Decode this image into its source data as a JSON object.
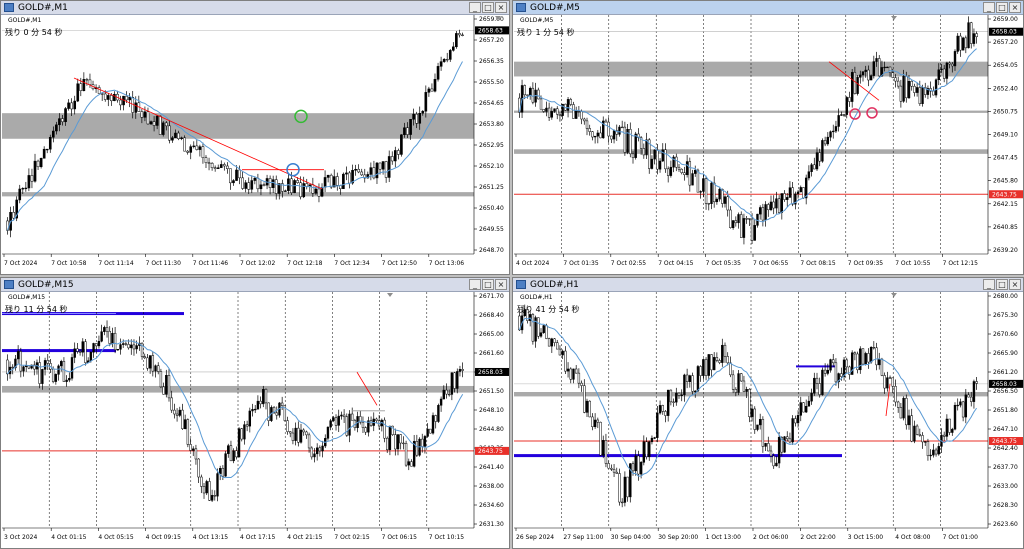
{
  "windows": [
    {
      "id": "m1",
      "title": "GOLD#,M1",
      "symbol": "GOLD#,M1",
      "countdown": "残り 0 分 54 秒",
      "active": false,
      "price_min": 2648.15,
      "price_max": 2659.35,
      "trend": [
        2649.7,
        2656.4,
        2654.2,
        2651.7,
        2651.2,
        2652.1,
        2658.6
      ],
      "price_labels": [
        "2659.00",
        "2657.20",
        "2656.35",
        "2655.50",
        "2654.65",
        "2653.80",
        "2652.95",
        "2652.10",
        "2651.25",
        "2650.40",
        "2649.55",
        "2648.70"
      ],
      "current_price": "2658.63",
      "current_value": 2658.63,
      "time_labels": [
        "7 Oct 2024",
        "7 Oct 10:58",
        "7 Oct 11:14",
        "7 Oct 11:30",
        "7 Oct 11:46",
        "7 Oct 12:02",
        "7 Oct 12:18",
        "7 Oct 12:34",
        "7 Oct 12:50",
        "7 Oct 13:06"
      ],
      "zones": [
        [
          2653.55,
          2654.75
        ],
        [
          2650.85,
          2651.05
        ]
      ],
      "red_lines": [],
      "blue_lines": [],
      "colors": {
        "zone": "#aaaaaa",
        "ma": "#5b9bd5",
        "trend": "#ff0000",
        "circle_green": "#33bb33",
        "circle_blue": "#3a7fd0"
      }
    },
    {
      "id": "m5",
      "title": "GOLD#,M5",
      "symbol": "GOLD#,M5",
      "countdown": "残り 1 分 54 秒",
      "active": true,
      "price_min": 2638.5,
      "price_max": 2659.5,
      "trend": [
        2652.2,
        2650.8,
        2647.9,
        2645.4,
        2640.5,
        2644.5,
        2655.2,
        2652.1,
        2658.7
      ],
      "price_labels": [
        "2659.00",
        "2658.03",
        "2657.20",
        "2654.05",
        "2652.40",
        "2650.75",
        "2649.10",
        "2647.45",
        "2645.80",
        "2643.75",
        "2642.15",
        "2640.85",
        "2639.20"
      ],
      "current_price": "2658.03",
      "current_value": 2658.03,
      "red_price": "2643.75",
      "red_value": 2643.75,
      "time_labels": [
        "4 Oct 2024",
        "7 Oct 01:35",
        "7 Oct 02:55",
        "7 Oct 04:15",
        "7 Oct 05:35",
        "7 Oct 06:55",
        "7 Oct 08:15",
        "7 Oct 09:35",
        "7 Oct 10:55",
        "7 Oct 12:15"
      ],
      "zones": [
        [
          2654.1,
          2655.4
        ],
        [
          2650.9,
          2651.1
        ],
        [
          2647.3,
          2647.7
        ]
      ],
      "red_lines": [
        2643.75
      ],
      "blue_lines": [],
      "colors": {
        "zone": "#aaaaaa",
        "ma": "#5b9bd5",
        "trend": "#ff0000",
        "circle": "#e03060",
        "red_tag": "#e8302a"
      }
    },
    {
      "id": "m15",
      "title": "GOLD#,M15",
      "symbol": "GOLD#,M15",
      "countdown": "残り 11 分 54 秒",
      "active": false,
      "price_min": 2629.8,
      "price_max": 2672.5,
      "trend": [
        2660.2,
        2657.0,
        2665.5,
        2658.5,
        2636.0,
        2653.0,
        2645.0,
        2650.0,
        2642.5,
        2659.0
      ],
      "price_labels": [
        "2671.70",
        "2668.40",
        "2665.00",
        "2661.60",
        "2658.03",
        "2654.90",
        "2651.50",
        "2648.10",
        "2644.80",
        "2643.35",
        "2641.40",
        "2638.00",
        "2634.60",
        "2631.30"
      ],
      "current_price": "2658.03",
      "current_value": 2658.03,
      "red_price": "2643.75",
      "red_value": 2643.75,
      "time_labels": [
        "3 Oct 2024",
        "4 Oct 01:15",
        "4 Oct 05:15",
        "4 Oct 09:15",
        "4 Oct 13:15",
        "4 Oct 17:15",
        "4 Oct 21:15",
        "7 Oct 02:15",
        "7 Oct 06:15",
        "7 Oct 10:15"
      ],
      "zones": [
        [
          2654.3,
          2655.5
        ]
      ],
      "red_lines": [
        2643.75
      ],
      "blue_lines": [
        2668.6
      ],
      "colors": {
        "zone": "#aaaaaa",
        "ma": "#5b9bd5",
        "trend": "#ff0000",
        "blue_zone": "#2200dd",
        "red_tag": "#e8302a"
      }
    },
    {
      "id": "h1",
      "title": "GOLD#,H1",
      "symbol": "GOLD#,H1",
      "countdown": "残り 41 分 54 秒",
      "active": false,
      "price_min": 2622.0,
      "price_max": 2681.0,
      "trend": [
        2675.0,
        2663.0,
        2630.0,
        2655.0,
        2665.0,
        2640.0,
        2660.0,
        2665.0,
        2640.0,
        2657.0
      ],
      "price_labels": [
        "2680.00",
        "2675.30",
        "2670.60",
        "2665.90",
        "2661.20",
        "2658.03",
        "2656.50",
        "2651.80",
        "2647.10",
        "2643.75",
        "2642.40",
        "2637.70",
        "2633.00",
        "2628.30",
        "2623.60"
      ],
      "current_price": "2658.03",
      "current_value": 2658.03,
      "red_price": "2643.75",
      "red_value": 2643.75,
      "time_labels": [
        "26 Sep 2024",
        "27 Sep 11:00",
        "30 Sep 04:00",
        "30 Sep 20:00",
        "1 Oct 13:00",
        "2 Oct 06:00",
        "2 Oct 22:00",
        "3 Oct 15:00",
        "4 Oct 08:00",
        "7 Oct 01:00"
      ],
      "zones": [
        [
          2654.9,
          2656.0
        ]
      ],
      "red_lines": [
        2643.75
      ],
      "blue_lines": [
        2640.1
      ],
      "colors": {
        "zone": "#aaaaaa",
        "ma": "#5b9bd5",
        "trend": "#ff0000",
        "blue_zone": "#2200dd",
        "red_tag": "#e8302a"
      }
    }
  ]
}
